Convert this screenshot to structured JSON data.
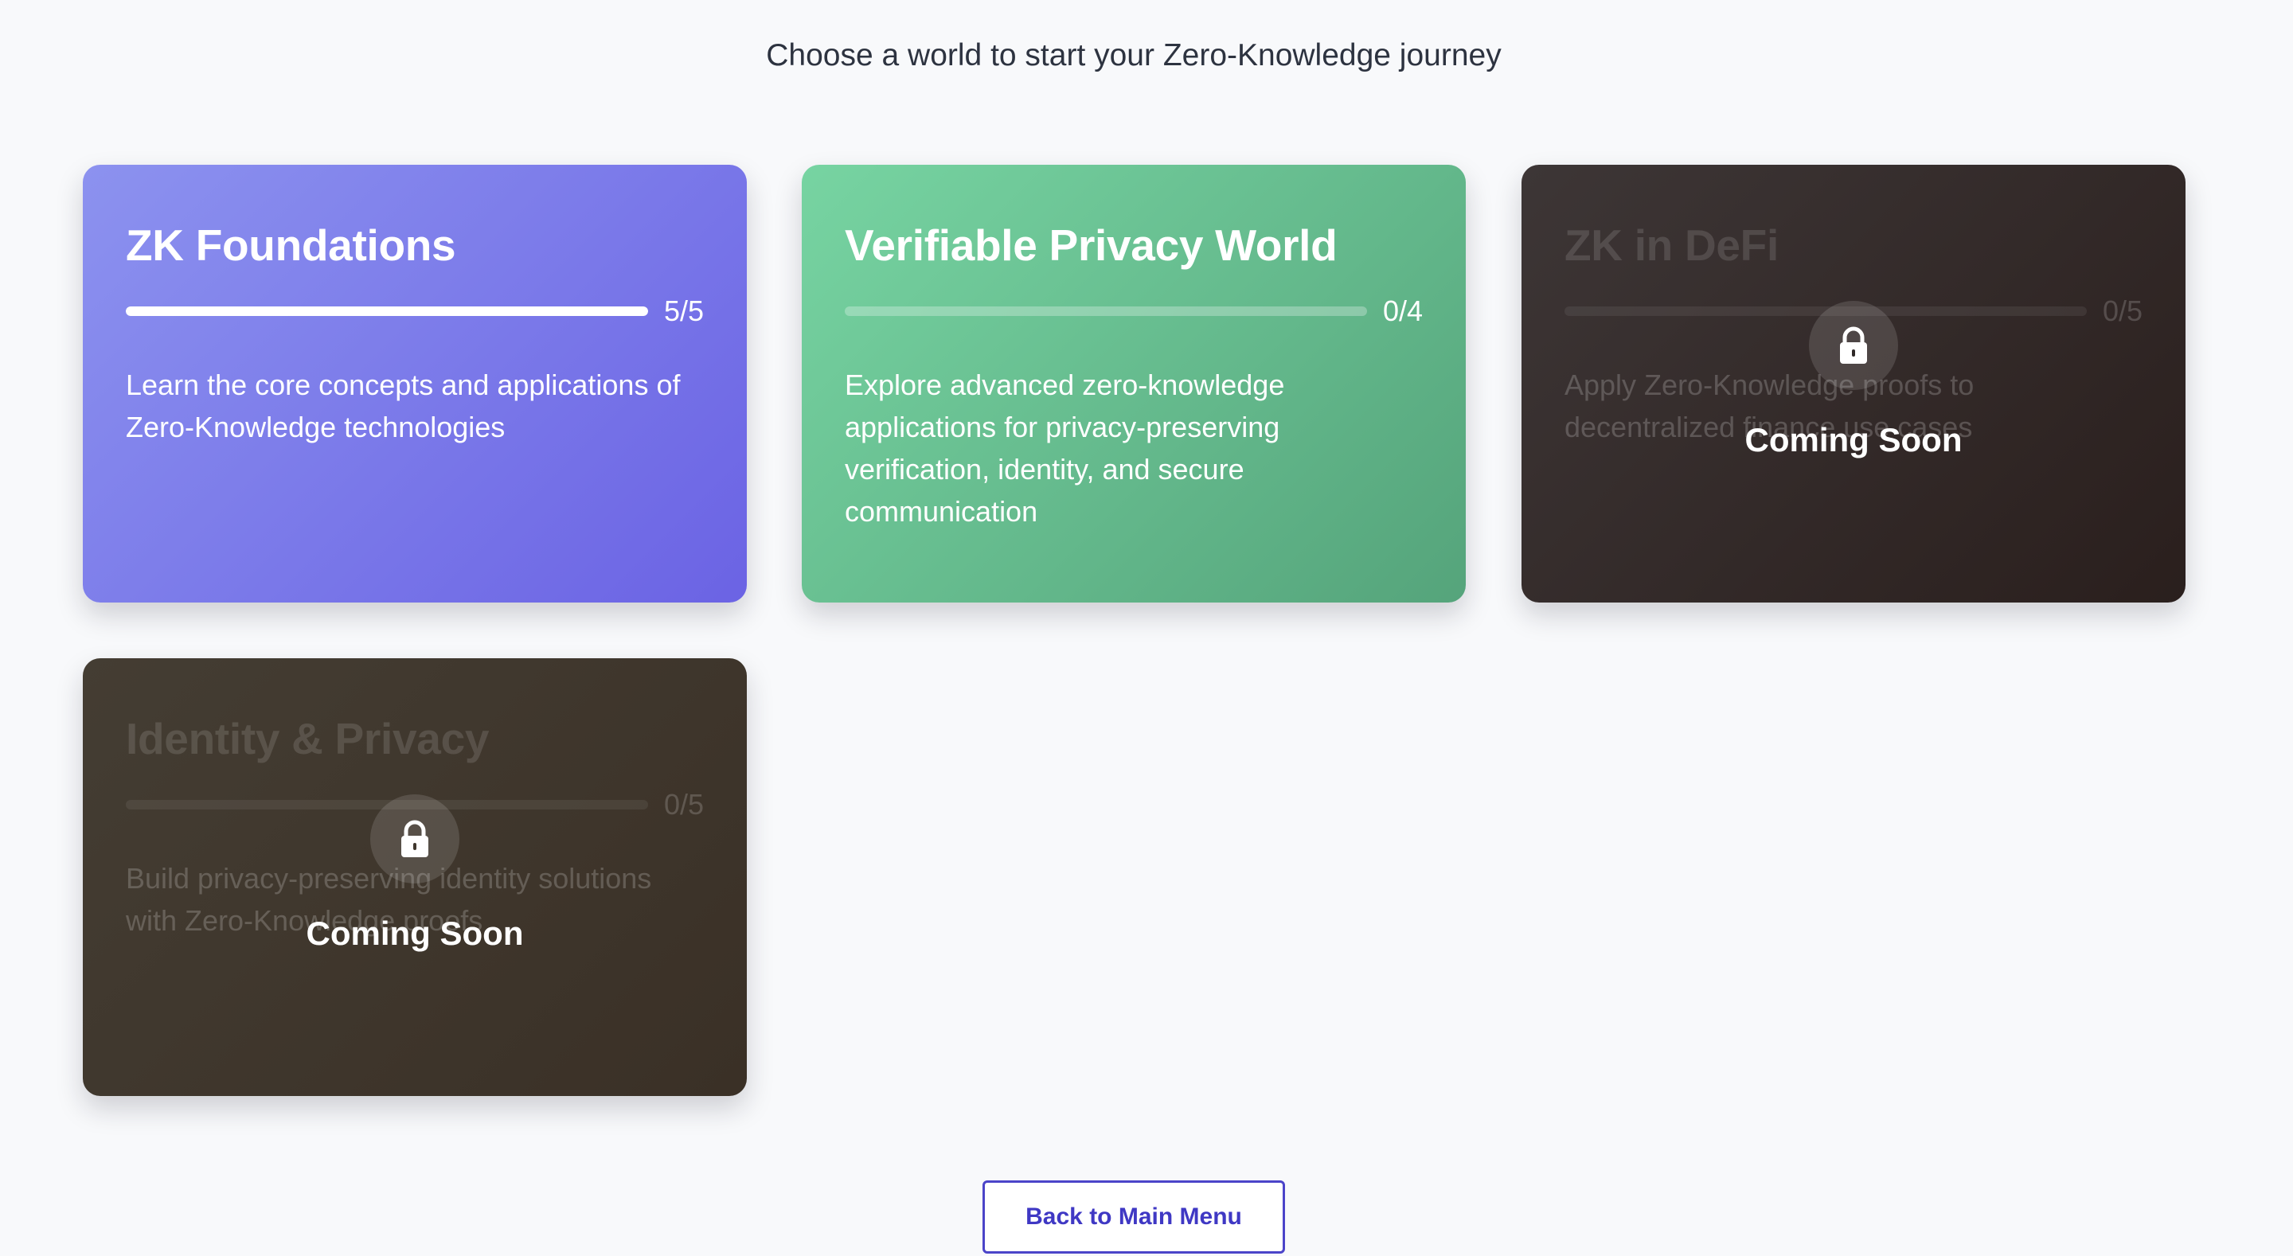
{
  "header": {
    "subtitle": "Choose a world to start your Zero-Knowledge journey"
  },
  "worlds": [
    {
      "title": "ZK Foundations",
      "progress_text": "5/5",
      "progress_fraction": 1.0,
      "description": "Learn the core concepts and applications of Zero-Knowledge technologies",
      "locked": false,
      "color_start": "#8c92ef",
      "color_end": "#6b63e4"
    },
    {
      "title": "Verifiable Privacy World",
      "progress_text": "0/4",
      "progress_fraction": 0.0,
      "description": "Explore advanced zero-knowledge applications for privacy-preserving verification, identity, and secure communication",
      "locked": false,
      "color_start": "#77d4a2",
      "color_end": "#55a47b"
    },
    {
      "title": "ZK in DeFi",
      "progress_text": "0/5",
      "progress_fraction": 0.0,
      "description": "Apply Zero-Knowledge proofs to decentralized finance use cases",
      "locked": true,
      "lock_label": "Coming Soon",
      "lock_icon": "lock-icon",
      "color_start": "#3d3636",
      "color_end": "#2a1f1d"
    },
    {
      "title": "Identity & Privacy",
      "progress_text": "0/5",
      "progress_fraction": 0.0,
      "description": "Build privacy-preserving identity solutions with Zero-Knowledge proofs",
      "locked": true,
      "lock_label": "Coming Soon",
      "lock_icon": "lock-icon",
      "color_start": "#443d33",
      "color_end": "#3a3026"
    }
  ],
  "footer": {
    "back_label": "Back to Main Menu"
  },
  "colors": {
    "background": "#f8f9fb",
    "accent": "#4b44c9"
  }
}
